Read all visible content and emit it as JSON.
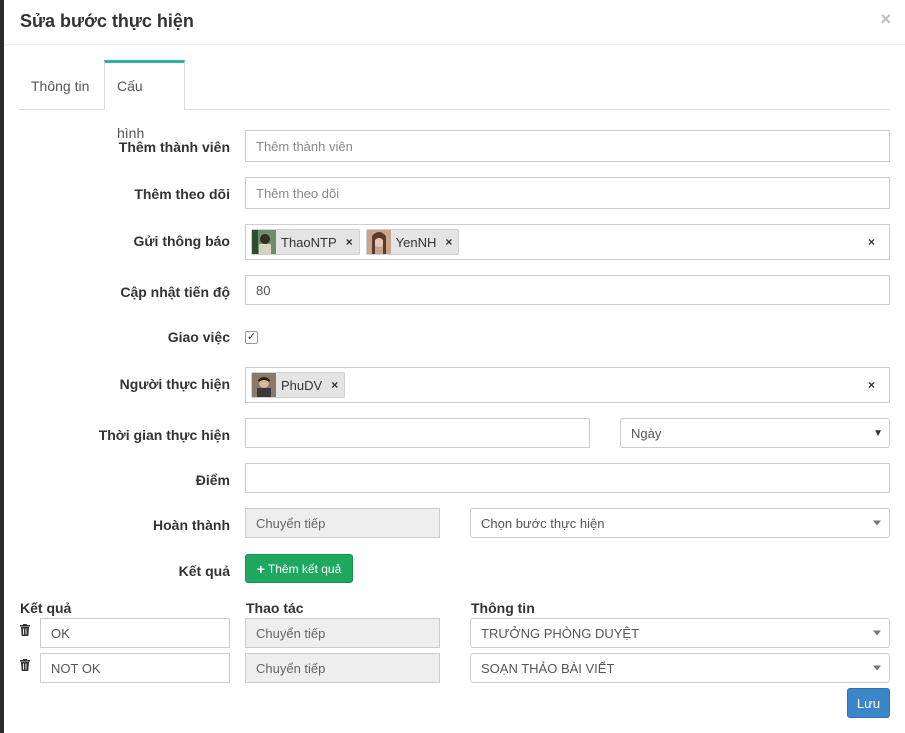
{
  "modal": {
    "title": "Sửa bước thực hiện",
    "close": "×"
  },
  "tabs": [
    {
      "label": "Thông tin"
    },
    {
      "label": "Cấu hình"
    }
  ],
  "form": {
    "add_member": {
      "label": "Thêm thành viên",
      "placeholder": "Thêm thành viên"
    },
    "add_follow": {
      "label": "Thêm theo dõi",
      "placeholder": "Thêm theo dõi"
    },
    "notify": {
      "label": "Gửi thông báo",
      "tags": [
        "ThaoNTP",
        "YenNH"
      ]
    },
    "progress": {
      "label": "Cập nhật tiến độ",
      "value": "80"
    },
    "assign": {
      "label": "Giao việc",
      "checked": true
    },
    "assignee": {
      "label": "Người thực hiện",
      "tags": [
        "PhuDV"
      ]
    },
    "duration": {
      "label": "Thời gian thực hiện",
      "value": "",
      "unit": "Ngày"
    },
    "score": {
      "label": "Điểm",
      "value": ""
    },
    "complete": {
      "label": "Hoàn thành",
      "action": "Chuyển tiếp",
      "step": "Chọn bước thực hiện"
    },
    "result": {
      "label": "Kết quả",
      "add_button": "Thêm kết quả"
    }
  },
  "results_table": {
    "headers": [
      "Kết quả",
      "Thao tác",
      "Thông tin"
    ],
    "rows": [
      {
        "result": "OK",
        "action": "Chuyển tiếp",
        "info": "TRƯỞNG PHÒNG DUYỆT"
      },
      {
        "result": "NOT OK",
        "action": "Chuyển tiếp",
        "info": "SOẠN THẢO BÀI VIẾT"
      }
    ]
  },
  "save_button": "Lưu",
  "colors": {
    "accent_tab": "#2bb3a0",
    "green": "#1fa85f",
    "blue": "#3a86c8"
  }
}
